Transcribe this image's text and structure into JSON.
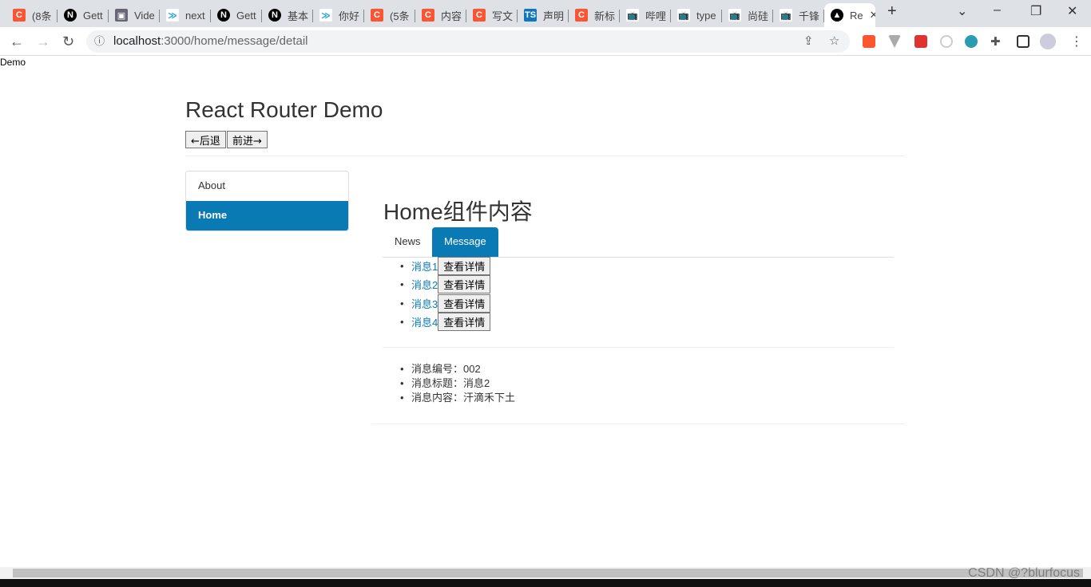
{
  "browser": {
    "tabs": [
      {
        "title": "(8条",
        "icon": "csdn-icon",
        "color": "#fc5531",
        "glyph": "C"
      },
      {
        "title": "Gett",
        "icon": "nextjs-icon",
        "color": "#000",
        "glyph": "N"
      },
      {
        "title": "Vide",
        "icon": "film-icon",
        "color": "#667",
        "glyph": "▣"
      },
      {
        "title": "next",
        "icon": "chevrons-icon",
        "color": "#fff",
        "glyph": "≫"
      },
      {
        "title": "Gett",
        "icon": "nextjs-icon",
        "color": "#000",
        "glyph": "N"
      },
      {
        "title": "基本",
        "icon": "nextjs-icon",
        "color": "#000",
        "glyph": "N"
      },
      {
        "title": "你好",
        "icon": "chevrons-icon",
        "color": "#fff",
        "glyph": "≫"
      },
      {
        "title": "(5条",
        "icon": "csdn-icon",
        "color": "#fc5531",
        "glyph": "C"
      },
      {
        "title": "内容",
        "icon": "csdn-icon",
        "color": "#fc5531",
        "glyph": "C"
      },
      {
        "title": "写文",
        "icon": "csdn-icon",
        "color": "#fc5531",
        "glyph": "C"
      },
      {
        "title": "声明",
        "icon": "typescript-icon",
        "color": "#1177bb",
        "glyph": "TS"
      },
      {
        "title": "新标",
        "icon": "csdn-icon",
        "color": "#fc5531",
        "glyph": "C"
      },
      {
        "title": "哔哩",
        "icon": "bilibili-icon",
        "color": "#fff",
        "glyph": "📺"
      },
      {
        "title": "type",
        "icon": "bilibili-icon",
        "color": "#fff",
        "glyph": "📺"
      },
      {
        "title": "尚硅",
        "icon": "bilibili-icon",
        "color": "#fff",
        "glyph": "📺"
      },
      {
        "title": "千锋",
        "icon": "bilibili-icon",
        "color": "#fff",
        "glyph": "📺"
      },
      {
        "title": "Re",
        "icon": "react-app-icon",
        "color": "#000",
        "glyph": "▲",
        "active": true
      }
    ],
    "url_host": "localhost",
    "url_path": ":3000/home/message/detail"
  },
  "page": {
    "doc_title": "Demo",
    "title": "React Router Demo",
    "back_label": "←后退",
    "forward_label": "前进→",
    "sidebar": [
      {
        "label": "About",
        "active": false
      },
      {
        "label": "Home",
        "active": true
      }
    ],
    "home_heading": "Home组件内容",
    "subtabs": [
      {
        "label": "News",
        "active": false
      },
      {
        "label": "Message",
        "active": true
      }
    ],
    "messages": [
      {
        "label": "消息1",
        "button": "查看详情"
      },
      {
        "label": "消息2",
        "button": "查看详情"
      },
      {
        "label": "消息3",
        "button": "查看详情"
      },
      {
        "label": "消息4",
        "button": "查看详情"
      }
    ],
    "detail": [
      "消息编号：002",
      "消息标题：消息2",
      "消息内容：汗滴禾下土"
    ],
    "accent": "#0a7ab5"
  },
  "watermark": "CSDN @?blurfocus"
}
